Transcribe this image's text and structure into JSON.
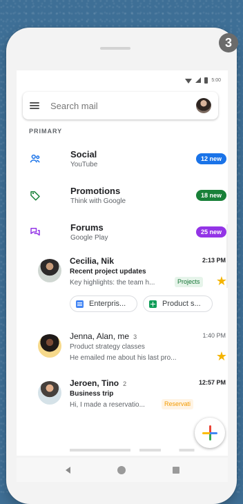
{
  "status_bar": {
    "time": "5:00"
  },
  "search": {
    "placeholder": "Search mail"
  },
  "sections": {
    "primary": "PRIMARY"
  },
  "categories": [
    {
      "title": "Social",
      "subtitle": "YouTube",
      "badge": "12 new",
      "badge_color": "#1a73e8"
    },
    {
      "title": "Promotions",
      "subtitle": "Think with Google",
      "badge": "18 new",
      "badge_color": "#188038"
    },
    {
      "title": "Forums",
      "subtitle": "Google Play",
      "badge": "25 new",
      "badge_color": "#9334e6"
    }
  ],
  "emails": [
    {
      "senders": "Cecilia, Nik",
      "count": "",
      "time": "2:13 PM",
      "subject": "Recent project updates",
      "snippet": "Key highlights: the team h...",
      "label": "Projects",
      "starred": true,
      "attachments": [
        "Enterpris...",
        "Product s..."
      ]
    },
    {
      "senders": "Jenna, Alan, me",
      "count": "3",
      "time": "1:40 PM",
      "subject": "Product strategy classes",
      "snippet": "He emailed me about his last pro...",
      "label": "",
      "starred": true
    },
    {
      "senders": "Jeroen, Tino",
      "count": "2",
      "time": "12:57 PM",
      "subject": "Business trip",
      "snippet": "Hi, I made a reservatio...",
      "label": "Reservati",
      "starred": false
    }
  ],
  "icons": {
    "top_right": "3",
    "menu": "menu-icon",
    "social": "people-icon",
    "promotions": "tag-icon",
    "forums": "forum-icon",
    "star": "★"
  },
  "colors": {
    "accent_blue": "#1a73e8",
    "accent_green": "#188038",
    "accent_purple": "#9334e6",
    "star": "#f4b400"
  }
}
